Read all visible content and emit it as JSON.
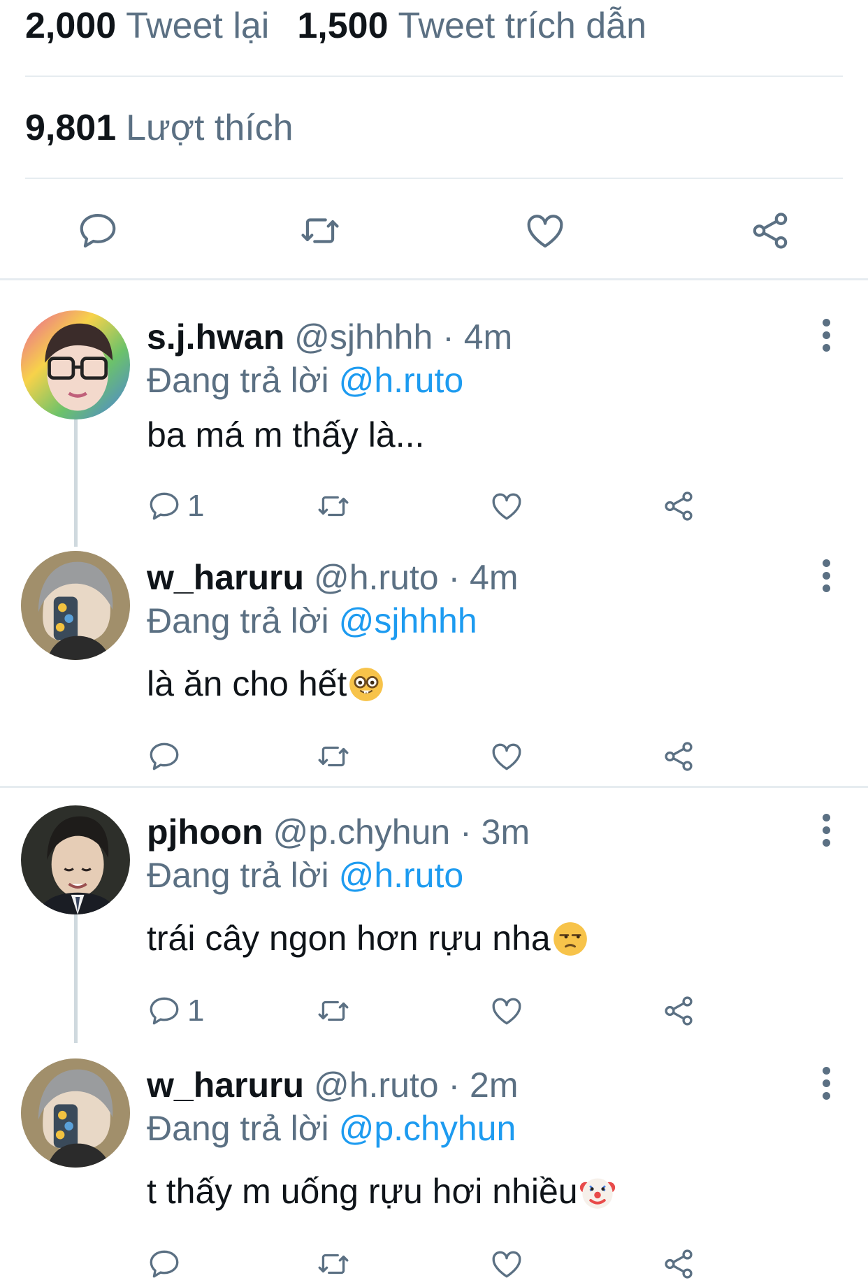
{
  "stats": {
    "retweets_count": "2,000",
    "retweets_label": "Tweet lại",
    "quotes_count": "1,500",
    "quotes_label": "Tweet trích dẫn",
    "likes_count": "9,801",
    "likes_label": "Lượt thích"
  },
  "main_actions": [
    "reply-icon",
    "retweet-icon",
    "heart-icon",
    "share-icon"
  ],
  "colors": {
    "text_primary": "#0f1419",
    "text_secondary": "#5b7083",
    "mention_blue": "#1d9bf0",
    "divider": "#e6ecf0"
  },
  "replies": [
    {
      "display_name": "s.j.hwan",
      "meta": "@sjhhhh · 4m",
      "replying_prefix": "Đang trả lời",
      "replying_to": "@h.ruto",
      "text": "ba má m thấy là...",
      "emoji": "",
      "reply_count": "1"
    },
    {
      "display_name": "w_haruru",
      "meta": "@h.ruto · 4m",
      "replying_prefix": "Đang trả lời",
      "replying_to": "@sjhhhh",
      "text": "là ăn cho hết",
      "emoji": "nerd-face-emoji",
      "reply_count": ""
    },
    {
      "display_name": "pjhoon",
      "meta": "@p.chyhun · 3m",
      "replying_prefix": "Đang trả lời",
      "replying_to": "@h.ruto",
      "text": "trái cây ngon hơn rựu nha",
      "emoji": "unamused-face-emoji",
      "reply_count": "1"
    },
    {
      "display_name": "w_haruru",
      "meta": "@h.ruto · 2m",
      "replying_prefix": "Đang trả lời",
      "replying_to": "@p.chyhun",
      "text": "t thấy m uống rựu hơi nhiều",
      "emoji": "clown-face-emoji",
      "reply_count": ""
    }
  ]
}
